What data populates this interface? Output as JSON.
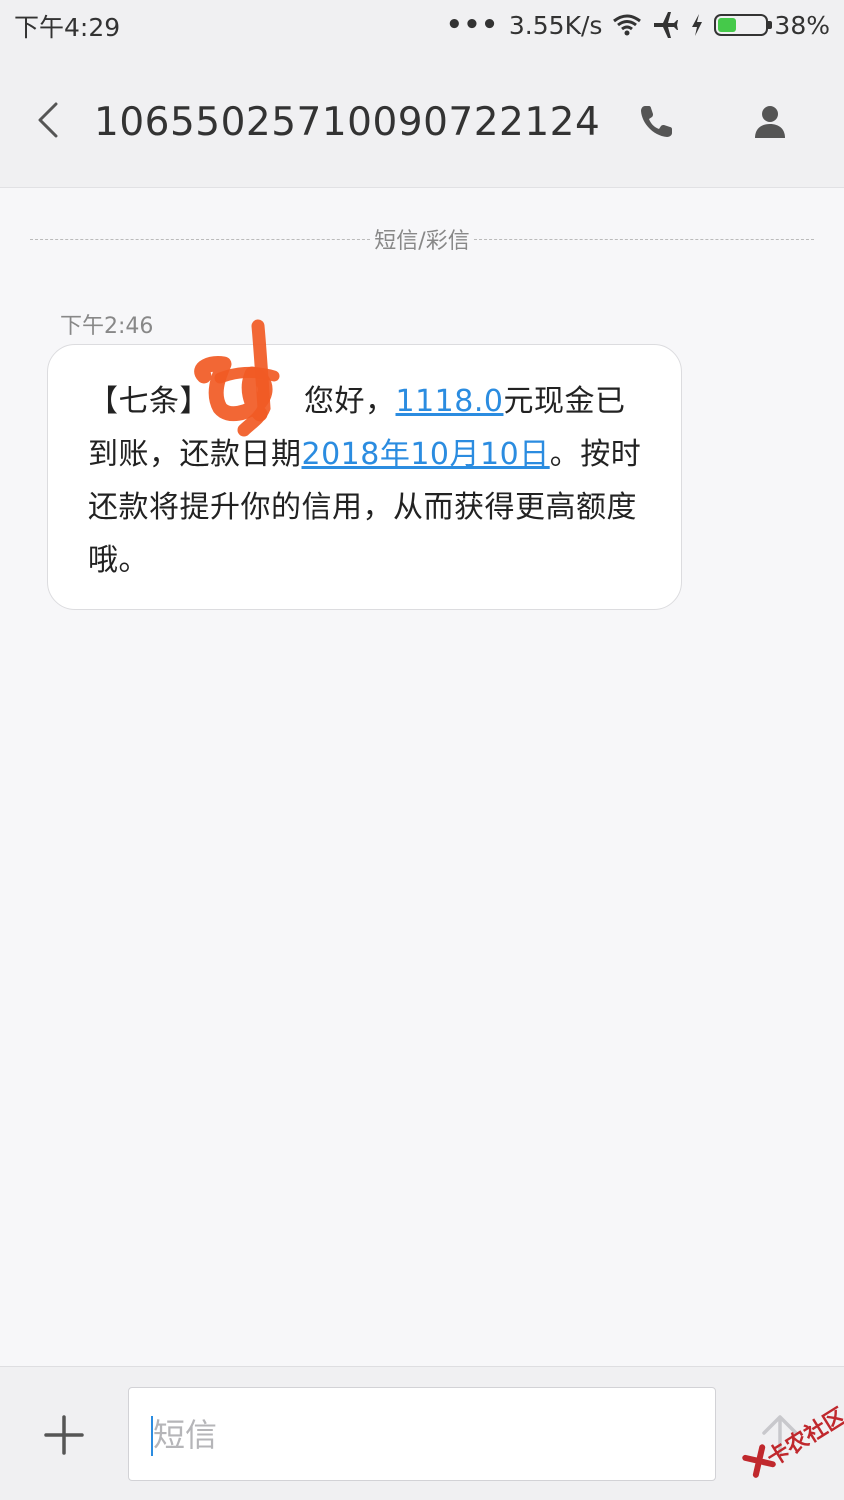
{
  "status_bar": {
    "time": "下午4:29",
    "network_speed": "3.55K/s",
    "battery_percent": "38%",
    "battery_level": 0.38,
    "icons": [
      "more-dots-icon",
      "wifi-icon",
      "airplane-icon",
      "charging-icon",
      "battery-icon"
    ]
  },
  "header": {
    "back_icon": "chevron-left-icon",
    "title": "10655025710090722124",
    "call_icon": "phone-icon",
    "contact_icon": "person-icon"
  },
  "thread": {
    "divider_label": "短信/彩信",
    "messages": [
      {
        "time": "下午2:46",
        "parts": [
          {
            "text": "【七条】",
            "link": false
          },
          {
            "text": "您好，",
            "link": false
          },
          {
            "text": "1118.0",
            "link": true
          },
          {
            "text": "元现金已到账，还款日期",
            "link": false
          },
          {
            "text": "2018年10月10日",
            "link": true
          },
          {
            "text": "。按时还款将提升你的信用，从而获得更高额度哦。",
            "link": false
          }
        ]
      }
    ]
  },
  "composer": {
    "add_icon": "plus-icon",
    "placeholder": "短信",
    "value": "",
    "send_icon": "arrow-up-icon"
  },
  "watermark": {
    "text": "卡农社区"
  },
  "colors": {
    "link": "#2b8ce0",
    "battery_fill": "#45c94a",
    "scribble": "#f15a24",
    "watermark": "#c0282d"
  }
}
